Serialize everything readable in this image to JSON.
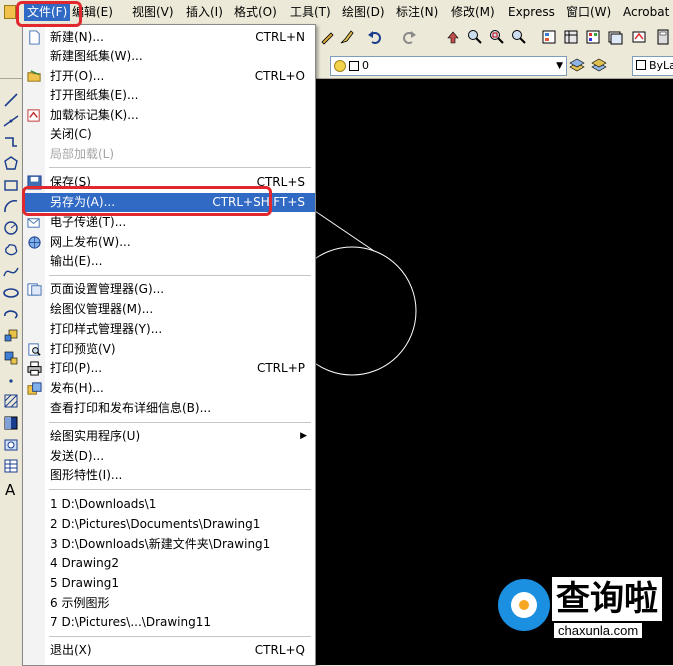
{
  "menubar": {
    "items": [
      "文件(F)",
      "编辑(E)",
      "视图(V)",
      "插入(I)",
      "格式(O)",
      "工具(T)",
      "绘图(D)",
      "标注(N)",
      "修改(M)",
      "Express",
      "窗口(W)",
      "Acrobat"
    ]
  },
  "toolbar2": {
    "layer_value": "0",
    "linetype_value": "ByLayer"
  },
  "file_menu": {
    "items": [
      {
        "label": "新建(N)...",
        "shortcut": "CTRL+N",
        "icon": "new-file-icon"
      },
      {
        "label": "新建图纸集(W)...",
        "shortcut": "",
        "icon": ""
      },
      {
        "label": "打开(O)...",
        "shortcut": "CTRL+O",
        "icon": "open-folder-icon"
      },
      {
        "label": "打开图纸集(E)...",
        "shortcut": "",
        "icon": ""
      },
      {
        "label": "加载标记集(K)...",
        "shortcut": "",
        "icon": "markup-icon"
      },
      {
        "label": "关闭(C)",
        "shortcut": "",
        "icon": ""
      },
      {
        "label": "局部加载(L)",
        "shortcut": "",
        "icon": ""
      },
      {
        "label": "保存(S)",
        "shortcut": "CTRL+S",
        "icon": "save-icon"
      },
      {
        "label": "另存为(A)...",
        "shortcut": "CTRL+SHIFT+S",
        "icon": ""
      },
      {
        "label": "电子传递(T)...",
        "shortcut": "",
        "icon": "etransmit-icon"
      },
      {
        "label": "网上发布(W)...",
        "shortcut": "",
        "icon": "publish-web-icon"
      },
      {
        "label": "输出(E)...",
        "shortcut": "",
        "icon": ""
      },
      {
        "label": "页面设置管理器(G)...",
        "shortcut": "",
        "icon": "page-setup-icon"
      },
      {
        "label": "绘图仪管理器(M)...",
        "shortcut": "",
        "icon": ""
      },
      {
        "label": "打印样式管理器(Y)...",
        "shortcut": "",
        "icon": ""
      },
      {
        "label": "打印预览(V)",
        "shortcut": "",
        "icon": "print-preview-icon"
      },
      {
        "label": "打印(P)...",
        "shortcut": "CTRL+P",
        "icon": "print-icon"
      },
      {
        "label": "发布(H)...",
        "shortcut": "",
        "icon": "publish-icon"
      },
      {
        "label": "查看打印和发布详细信息(B)...",
        "shortcut": "",
        "icon": ""
      },
      {
        "label": "绘图实用程序(U)",
        "shortcut": "",
        "icon": ""
      },
      {
        "label": "发送(D)...",
        "shortcut": "",
        "icon": ""
      },
      {
        "label": "图形特性(I)...",
        "shortcut": "",
        "icon": ""
      },
      {
        "label": "1 D:\\Downloads\\1",
        "shortcut": "",
        "icon": ""
      },
      {
        "label": "2 D:\\Pictures\\Documents\\Drawing1",
        "shortcut": "",
        "icon": ""
      },
      {
        "label": "3 D:\\Downloads\\新建文件夹\\Drawing1",
        "shortcut": "",
        "icon": ""
      },
      {
        "label": "4 Drawing2",
        "shortcut": "",
        "icon": ""
      },
      {
        "label": "5 Drawing1",
        "shortcut": "",
        "icon": ""
      },
      {
        "label": "6 示例图形",
        "shortcut": "",
        "icon": ""
      },
      {
        "label": "7 D:\\Pictures\\...\\Drawing11",
        "shortcut": "",
        "icon": ""
      },
      {
        "label": "退出(X)",
        "shortcut": "CTRL+Q",
        "icon": ""
      }
    ]
  },
  "watermark": {
    "brand": "查询啦",
    "domain": "chaxunla.com"
  },
  "colors": {
    "menu_highlight": "#316ac5",
    "annotation_red": "#e0282e",
    "canvas_bg": "#000000",
    "ui_bg": "#ece9d8"
  }
}
